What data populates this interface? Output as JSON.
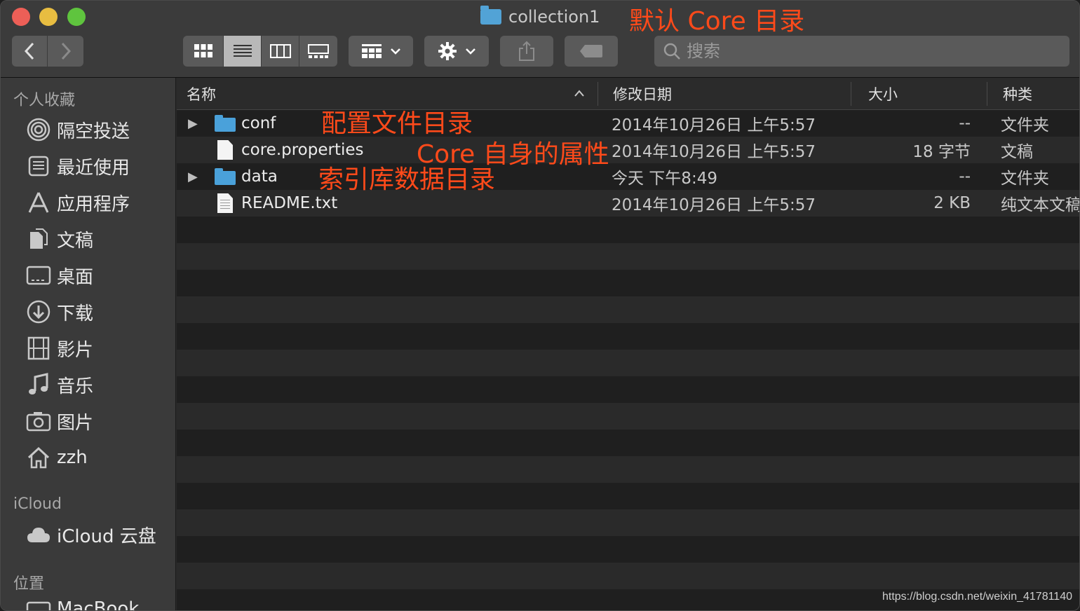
{
  "window": {
    "title": "collection1"
  },
  "toolbar": {
    "search_placeholder": "搜索"
  },
  "annotations": {
    "core_dir": "默认 Core 目录",
    "conf": "配置文件目录",
    "core_props": "Core 自身的属性",
    "data": "索引库数据目录"
  },
  "sidebar": {
    "favorites_title": "个人收藏",
    "favorites": [
      {
        "label": "隔空投送",
        "icon": "airdrop-icon"
      },
      {
        "label": "最近使用",
        "icon": "recents-icon"
      },
      {
        "label": "应用程序",
        "icon": "applications-icon"
      },
      {
        "label": "文稿",
        "icon": "documents-icon"
      },
      {
        "label": "桌面",
        "icon": "desktop-icon"
      },
      {
        "label": "下载",
        "icon": "downloads-icon"
      },
      {
        "label": "影片",
        "icon": "movies-icon"
      },
      {
        "label": "音乐",
        "icon": "music-icon"
      },
      {
        "label": "图片",
        "icon": "pictures-icon"
      },
      {
        "label": "zzh",
        "icon": "home-icon"
      }
    ],
    "icloud_title": "iCloud",
    "icloud_items": [
      {
        "label": "iCloud 云盘",
        "icon": "cloud-icon"
      }
    ],
    "locations_title": "位置",
    "locations": [
      {
        "label": "MacBook",
        "icon": "computer-icon"
      }
    ]
  },
  "table": {
    "columns": {
      "name": "名称",
      "date": "修改日期",
      "size": "大小",
      "kind": "种类"
    },
    "rows": [
      {
        "name": "conf",
        "date": "2014年10月26日 上午5:57",
        "size": "--",
        "kind": "文件夹",
        "type": "folder"
      },
      {
        "name": "core.properties",
        "date": "2014年10月26日 上午5:57",
        "size": "18 字节",
        "kind": "文稿",
        "type": "doc"
      },
      {
        "name": "data",
        "date": "今天 下午8:49",
        "size": "--",
        "kind": "文件夹",
        "type": "folder"
      },
      {
        "name": "README.txt",
        "date": "2014年10月26日 上午5:57",
        "size": "2 KB",
        "kind": "纯文本文稿",
        "type": "txt"
      }
    ]
  },
  "watermark": "https://blog.csdn.net/weixin_41781140",
  "colors": {
    "annotation": "#ff4a1a",
    "folder": "#4aa1da"
  }
}
